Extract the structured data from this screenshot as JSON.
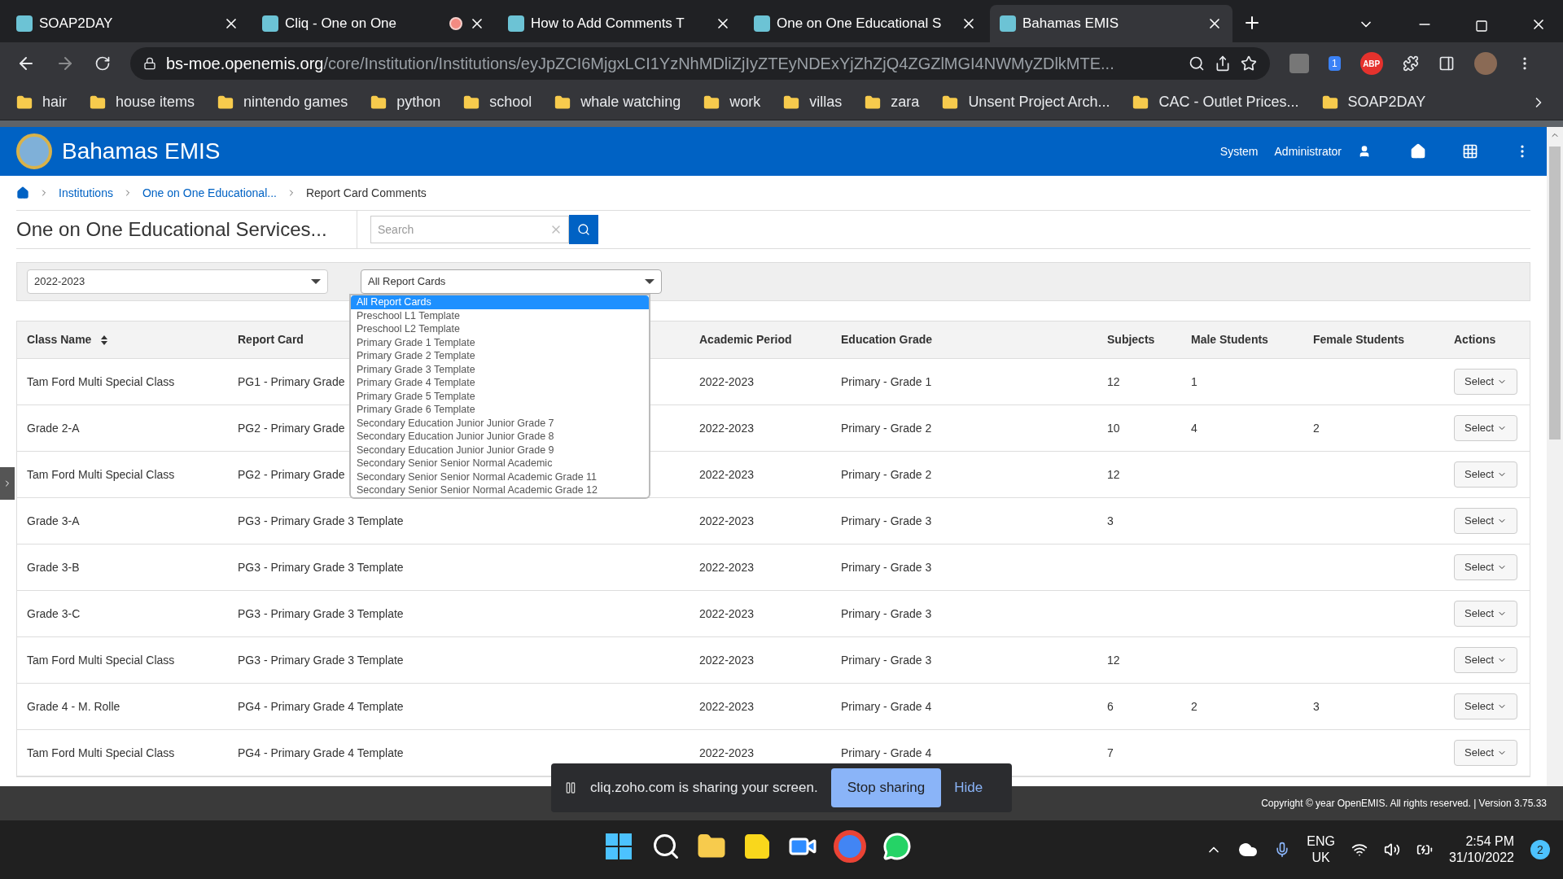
{
  "browser": {
    "tabs": [
      {
        "title": "SOAP2DAY",
        "selected": false,
        "recording": false
      },
      {
        "title": "Cliq - One on One",
        "selected": false,
        "recording": true
      },
      {
        "title": "How to Add Comments T",
        "selected": false,
        "recording": false
      },
      {
        "title": "One on One Educational S",
        "selected": false,
        "recording": false
      },
      {
        "title": "Bahamas EMIS",
        "selected": true,
        "recording": false
      }
    ],
    "address": {
      "host": "bs-moe.openemis.org",
      "path": "/core/Institution/Institutions/eyJpZCI6MjgxLCI1YzNhMDliZjIyZTEyNDExYjZhZjQ4ZGZlMGI4NWMyZDlkMTE..."
    },
    "extension_badge": "1",
    "adblock_label": "ABP",
    "bookmarks": [
      "hair",
      "house items",
      "nintendo games",
      "python",
      "school",
      "whale watching",
      "work",
      "villas",
      "zara",
      "Unsent Project Arch...",
      "CAC - Outlet Prices...",
      "SOAP2DAY"
    ]
  },
  "app": {
    "title": "Bahamas EMIS",
    "user": [
      "System",
      "Administrator"
    ]
  },
  "breadcrumb": [
    "Institutions",
    "One on One Educational...",
    "Report Card Comments"
  ],
  "page_title": "One on One Educational Services...",
  "search": {
    "placeholder": "Search"
  },
  "filters": {
    "year": "2022-2023",
    "report_card": "All Report Cards"
  },
  "report_card_options": [
    {
      "label": "All Report Cards",
      "selected": true
    },
    {
      "label": "Preschool L1 Template",
      "selected": false
    },
    {
      "label": "Preschool L2 Template",
      "selected": false
    },
    {
      "label": "Primary Grade 1 Template",
      "selected": false
    },
    {
      "label": "Primary Grade 2 Template",
      "selected": false
    },
    {
      "label": "Primary Grade 3 Template",
      "selected": false
    },
    {
      "label": "Primary Grade 4 Template",
      "selected": false
    },
    {
      "label": "Primary Grade 5 Template",
      "selected": false
    },
    {
      "label": "Primary Grade 6 Template",
      "selected": false
    },
    {
      "label": "Secondary Education Junior Junior Grade 7",
      "selected": false
    },
    {
      "label": "Secondary Education Junior Junior Grade 8",
      "selected": false
    },
    {
      "label": "Secondary Education Junior Junior Grade 9",
      "selected": false
    },
    {
      "label": "Secondary Senior Senior Normal Academic",
      "selected": false
    },
    {
      "label": "Secondary Senior Senior Normal Academic Grade 11",
      "selected": false
    },
    {
      "label": "Secondary Senior Senior Normal Academic Grade 12",
      "selected": false
    }
  ],
  "table": {
    "columns": [
      "Class Name",
      "Report Card",
      "Academic Period",
      "Education Grade",
      "Subjects",
      "Male Students",
      "Female Students",
      "Actions"
    ],
    "rows": [
      {
        "cells": [
          "Tam Ford Multi Special Class",
          "PG1 - Primary Grade",
          "2022-2023",
          "Primary - Grade 1",
          "12",
          "1",
          ""
        ],
        "action": "Select"
      },
      {
        "cells": [
          "Grade 2-A",
          "PG2 - Primary Grade",
          "2022-2023",
          "Primary - Grade 2",
          "10",
          "4",
          "2"
        ],
        "action": "Select"
      },
      {
        "cells": [
          "Tam Ford Multi Special Class",
          "PG2 - Primary Grade",
          "2022-2023",
          "Primary - Grade 2",
          "12",
          "",
          ""
        ],
        "action": "Select"
      },
      {
        "cells": [
          "Grade 3-A",
          "PG3 - Primary Grade 3 Template",
          "2022-2023",
          "Primary - Grade 3",
          "3",
          "",
          ""
        ],
        "action": "Select"
      },
      {
        "cells": [
          "Grade 3-B",
          "PG3 - Primary Grade 3 Template",
          "2022-2023",
          "Primary - Grade 3",
          "",
          "",
          ""
        ],
        "action": "Select"
      },
      {
        "cells": [
          "Grade 3-C",
          "PG3 - Primary Grade 3 Template",
          "2022-2023",
          "Primary - Grade 3",
          "",
          "",
          ""
        ],
        "action": "Select"
      },
      {
        "cells": [
          "Tam Ford Multi Special Class",
          "PG3 - Primary Grade 3 Template",
          "2022-2023",
          "Primary - Grade 3",
          "12",
          "",
          ""
        ],
        "action": "Select"
      },
      {
        "cells": [
          "Grade 4 - M. Rolle",
          "PG4 - Primary Grade 4 Template",
          "2022-2023",
          "Primary - Grade 4",
          "6",
          "2",
          "3"
        ],
        "action": "Select"
      },
      {
        "cells": [
          "Tam Ford Multi Special Class",
          "PG4 - Primary Grade 4 Template",
          "2022-2023",
          "Primary - Grade 4",
          "7",
          "",
          ""
        ],
        "action": "Select"
      }
    ]
  },
  "footer": "Copyright © year OpenEMIS. All rights reserved. | Version 3.75.33",
  "share_bar": {
    "message": "cliq.zoho.com is sharing your screen.",
    "stop": "Stop sharing",
    "hide": "Hide"
  },
  "taskbar": {
    "lang": [
      "ENG",
      "UK"
    ],
    "time": "2:54 PM",
    "date": "31/10/2022",
    "notifications": "2"
  }
}
